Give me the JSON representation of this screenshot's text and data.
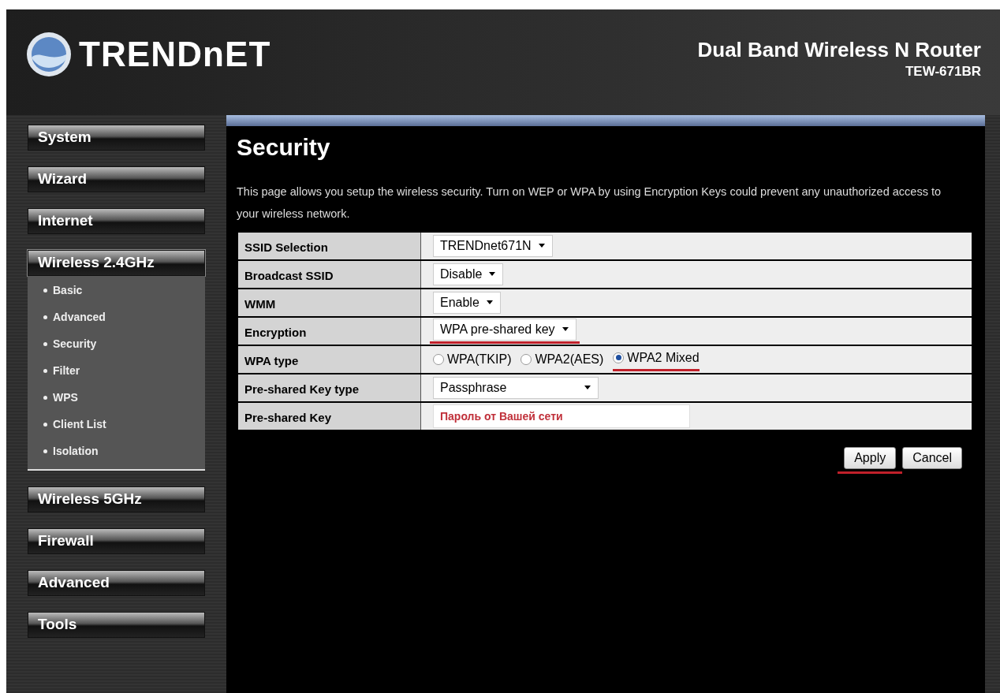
{
  "header": {
    "logo_text": "TRENDnET",
    "product": "Dual Band Wireless N Router",
    "model": "TEW-671BR"
  },
  "sidebar": {
    "items": [
      {
        "label": "System",
        "expanded": false
      },
      {
        "label": "Wizard",
        "expanded": false
      },
      {
        "label": "Internet",
        "expanded": false
      },
      {
        "label": "Wireless 2.4GHz",
        "expanded": true,
        "children": [
          {
            "label": "Basic"
          },
          {
            "label": "Advanced"
          },
          {
            "label": "Security"
          },
          {
            "label": "Filter"
          },
          {
            "label": "WPS"
          },
          {
            "label": "Client List"
          },
          {
            "label": "Isolation"
          }
        ]
      },
      {
        "label": "Wireless 5GHz",
        "expanded": false
      },
      {
        "label": "Firewall",
        "expanded": false
      },
      {
        "label": "Advanced",
        "expanded": false
      },
      {
        "label": "Tools",
        "expanded": false
      }
    ]
  },
  "page": {
    "title": "Security",
    "description": "This page allows you setup the wireless security. Turn on WEP or WPA by using Encryption Keys could prevent any unauthorized access to your wireless network.",
    "rows": [
      {
        "label": "SSID Selection",
        "kind": "select",
        "value": "TRENDnet671N",
        "marked": false
      },
      {
        "label": "Broadcast SSID",
        "kind": "select",
        "value": "Disable",
        "marked": false
      },
      {
        "label": "WMM",
        "kind": "select",
        "value": "Enable",
        "marked": false
      },
      {
        "label": "Encryption",
        "kind": "select",
        "value": "WPA pre-shared key",
        "marked": true
      },
      {
        "label": "WPA type",
        "kind": "radio",
        "options": [
          {
            "label": "WPA(TKIP)",
            "selected": false,
            "marked": false
          },
          {
            "label": "WPA2(AES)",
            "selected": false,
            "marked": false
          },
          {
            "label": "WPA2 Mixed",
            "selected": true,
            "marked": true
          }
        ]
      },
      {
        "label": "Pre-shared Key type",
        "kind": "select",
        "value": "Passphrase",
        "marked": false
      },
      {
        "label": "Pre-shared Key",
        "kind": "text",
        "value": "Пароль от Вашей сети"
      }
    ],
    "buttons": [
      {
        "label": "Apply",
        "marked": true
      },
      {
        "label": "Cancel",
        "marked": false
      }
    ]
  }
}
